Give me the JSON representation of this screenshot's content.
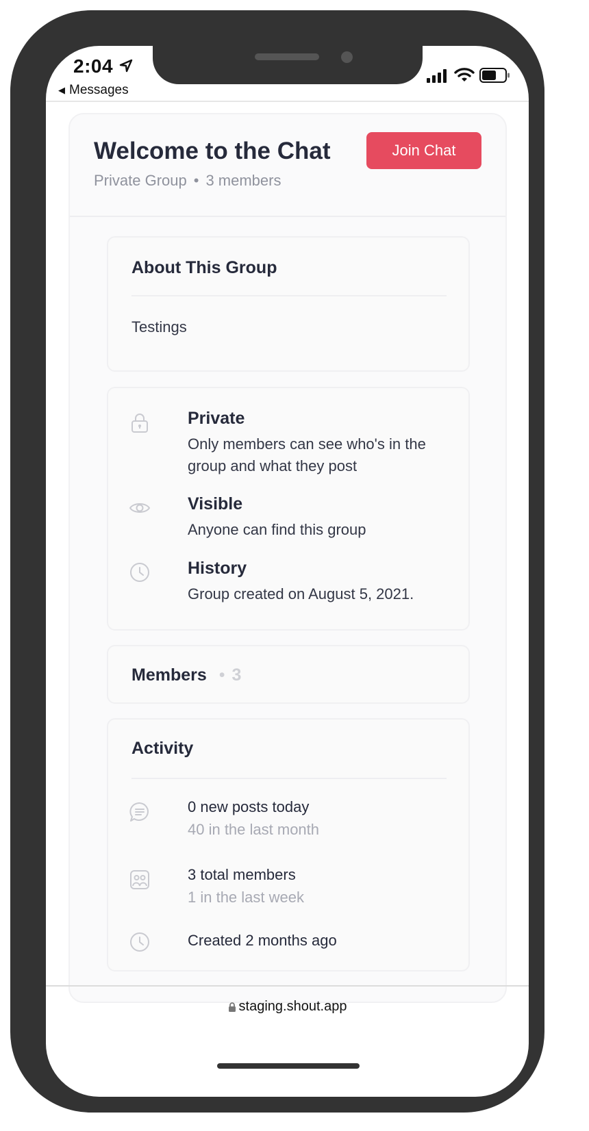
{
  "status_bar": {
    "time": "2:04",
    "back_label": "Messages"
  },
  "header": {
    "title": "Welcome to the Chat",
    "privacy": "Private Group",
    "separator": "•",
    "member_count": "3 members",
    "join_label": "Join Chat"
  },
  "about": {
    "title": "About This Group",
    "description": "Testings"
  },
  "info": [
    {
      "icon": "lock-icon",
      "label": "Private",
      "description": "Only members can see who's in the group and what they post"
    },
    {
      "icon": "eye-icon",
      "label": "Visible",
      "description": "Anyone can find this group"
    },
    {
      "icon": "clock-icon",
      "label": "History",
      "description": "Group created on August 5, 2021."
    }
  ],
  "members": {
    "title": "Members",
    "separator": "•",
    "count": "3"
  },
  "activity": {
    "title": "Activity",
    "items": [
      {
        "icon": "chat-bubble-icon",
        "primary": "0 new posts today",
        "secondary": "40 in the last month"
      },
      {
        "icon": "members-icon",
        "primary": "3 total members",
        "secondary": "1 in the last week"
      },
      {
        "icon": "clock-icon",
        "primary": "Created 2 months ago",
        "secondary": ""
      }
    ]
  },
  "browser": {
    "url": "staging.shout.app"
  },
  "colors": {
    "accent": "#e64b5f",
    "phone_frame": "#333333",
    "text_primary": "#262a3b",
    "text_muted": "#8f929d"
  }
}
